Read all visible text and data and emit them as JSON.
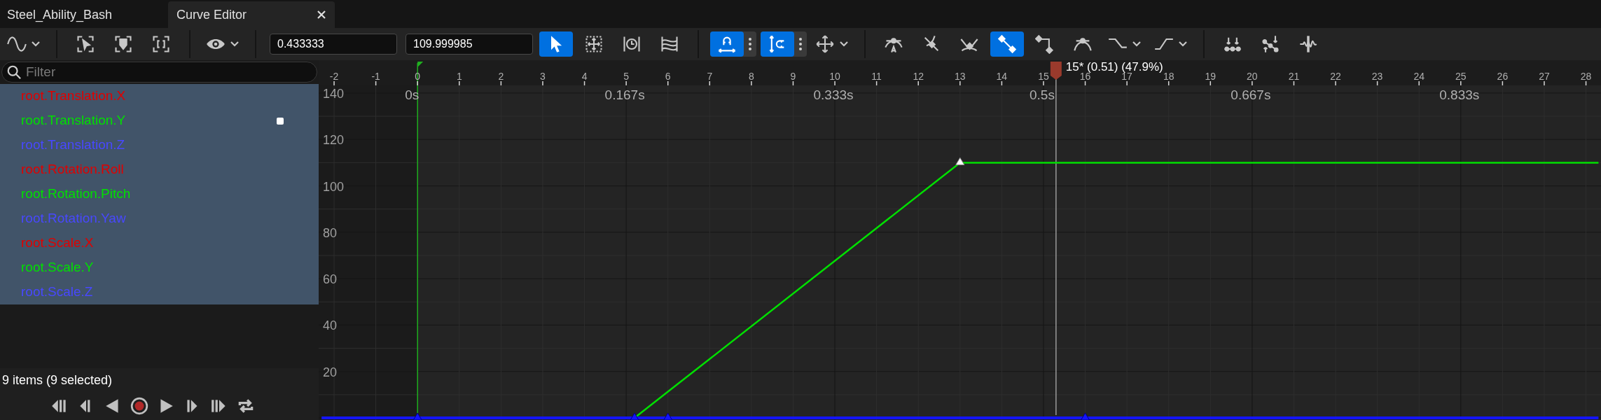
{
  "tabs": [
    {
      "label": "Steel_Ability_Bash",
      "selected": false,
      "closable": false
    },
    {
      "label": "Curve Editor",
      "selected": true,
      "closable": true
    }
  ],
  "toolbar": [
    {
      "kind": "button",
      "selected": false,
      "dropdown": true,
      "options": false
    },
    {
      "kind": "separator"
    },
    {
      "kind": "button",
      "selected": false,
      "dropdown": false,
      "options": false
    },
    {
      "kind": "button",
      "selected": false,
      "dropdown": false,
      "options": false
    },
    {
      "kind": "button",
      "selected": false,
      "dropdown": false,
      "options": false
    },
    {
      "kind": "separator"
    },
    {
      "kind": "button",
      "selected": false,
      "dropdown": true,
      "options": false
    },
    {
      "kind": "separator"
    },
    {
      "kind": "field",
      "value": "0.433333"
    },
    {
      "kind": "field",
      "value": "109.999985"
    },
    {
      "kind": "button",
      "selected": true,
      "dropdown": false,
      "options": false
    },
    {
      "kind": "button",
      "selected": false,
      "dropdown": false,
      "options": false
    },
    {
      "kind": "button",
      "selected": false,
      "dropdown": false,
      "options": false
    },
    {
      "kind": "button",
      "selected": false,
      "dropdown": false,
      "options": false
    },
    {
      "kind": "separator"
    },
    {
      "kind": "button",
      "selected": true,
      "dropdown": false,
      "options": true
    },
    {
      "kind": "button",
      "selected": true,
      "dropdown": false,
      "options": true
    },
    {
      "kind": "button",
      "selected": false,
      "dropdown": true,
      "options": false
    },
    {
      "kind": "separator"
    },
    {
      "kind": "button",
      "selected": false,
      "dropdown": false,
      "options": false
    },
    {
      "kind": "button",
      "selected": false,
      "dropdown": false,
      "options": false
    },
    {
      "kind": "button",
      "selected": false,
      "dropdown": false,
      "options": false
    },
    {
      "kind": "button",
      "selected": true,
      "dropdown": false,
      "options": false
    },
    {
      "kind": "button",
      "selected": false,
      "dropdown": false,
      "options": false
    },
    {
      "kind": "button",
      "selected": false,
      "dropdown": false,
      "options": false
    },
    {
      "kind": "button",
      "selected": false,
      "dropdown": true,
      "options": false
    },
    {
      "kind": "button",
      "selected": false,
      "dropdown": true,
      "options": false
    },
    {
      "kind": "separator"
    },
    {
      "kind": "button",
      "selected": false,
      "dropdown": false,
      "options": false
    },
    {
      "kind": "button",
      "selected": false,
      "dropdown": false,
      "options": false
    },
    {
      "kind": "button",
      "selected": false,
      "dropdown": false,
      "options": false
    }
  ],
  "filter": {
    "placeholder": "Filter"
  },
  "curves": [
    {
      "name": "root.Translation.X",
      "color": "#e00000",
      "selected": true,
      "key_selected": false
    },
    {
      "name": "root.Translation.Y",
      "color": "#00e000",
      "selected": true,
      "key_selected": true
    },
    {
      "name": "root.Translation.Z",
      "color": "#4848ff",
      "selected": true,
      "key_selected": false
    },
    {
      "name": "root.Rotation.Roll",
      "color": "#e00000",
      "selected": true,
      "key_selected": false
    },
    {
      "name": "root.Rotation.Pitch",
      "color": "#00e000",
      "selected": true,
      "key_selected": false
    },
    {
      "name": "root.Rotation.Yaw",
      "color": "#4848ff",
      "selected": true,
      "key_selected": false
    },
    {
      "name": "root.Scale.X",
      "color": "#e00000",
      "selected": true,
      "key_selected": false
    },
    {
      "name": "root.Scale.Y",
      "color": "#00e000",
      "selected": true,
      "key_selected": false
    },
    {
      "name": "root.Scale.Z",
      "color": "#4848ff",
      "selected": true,
      "key_selected": false
    }
  ],
  "status": "9 items (9 selected)",
  "graph": {
    "time_labels": [
      "0s",
      "0.167s",
      "0.333s",
      "0.5s",
      "0.667s",
      "0.833s"
    ],
    "chart_data": {
      "type": "line",
      "x": [
        -2.3,
        0,
        5.2,
        6,
        13,
        16,
        28.3
      ],
      "series": [
        {
          "color": "#00e000",
          "values": [
            null,
            null,
            0,
            11.3,
            110,
            110,
            110
          ]
        },
        {
          "color": "#1414ff",
          "values": [
            0,
            0,
            0,
            0,
            0,
            0,
            0
          ]
        }
      ],
      "xlim": [
        -2.37,
        28.36
      ],
      "ylim": [
        -0.9,
        143.3
      ],
      "grid": true,
      "xticks": [
        -2,
        -1,
        0,
        1,
        2,
        3,
        4,
        5,
        6,
        7,
        8,
        9,
        10,
        11,
        12,
        13,
        14,
        15,
        16,
        17,
        18,
        19,
        20,
        21,
        22,
        23,
        24,
        25,
        26,
        27,
        28
      ],
      "yticks": [
        20,
        40,
        60,
        80,
        100,
        120,
        140
      ],
      "ref_lines": [
        {
          "axis": "x",
          "value": 0,
          "color": "#20b020"
        },
        {
          "axis": "x",
          "value": 15.3,
          "color": "#9a9a9a",
          "label": "15* (0.51) (47.9%)"
        }
      ]
    }
  }
}
